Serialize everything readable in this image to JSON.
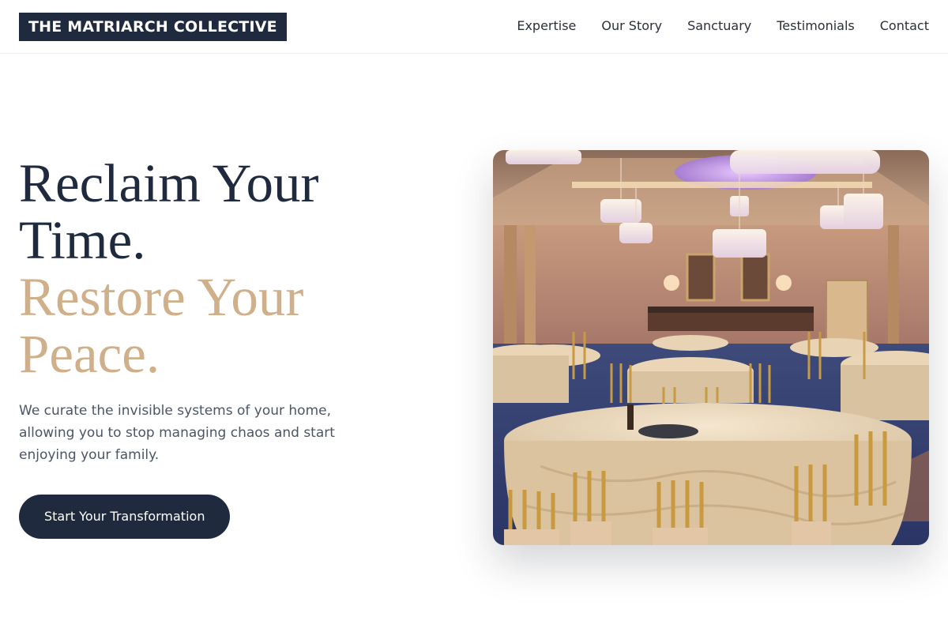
{
  "header": {
    "logo_text": "THE MATRIARCH COLLECTIVE",
    "nav": [
      {
        "label": "Expertise"
      },
      {
        "label": "Our Story"
      },
      {
        "label": "Sanctuary"
      },
      {
        "label": "Testimonials"
      },
      {
        "label": "Contact"
      }
    ]
  },
  "hero": {
    "headline_line1": "Reclaim Your",
    "headline_line2": "Time.",
    "headline_line3": "Restore Your",
    "headline_line4": "Peace.",
    "subtext": "We curate the invisible systems of your home, allowing you to stop managing chaos and start enjoying your family.",
    "cta_label": "Start Your Transformation",
    "image": "banquet-hall-photo"
  },
  "colors": {
    "navy": "#1f2a3e",
    "gold": "#cfb08a",
    "body_text": "#4c5566"
  }
}
